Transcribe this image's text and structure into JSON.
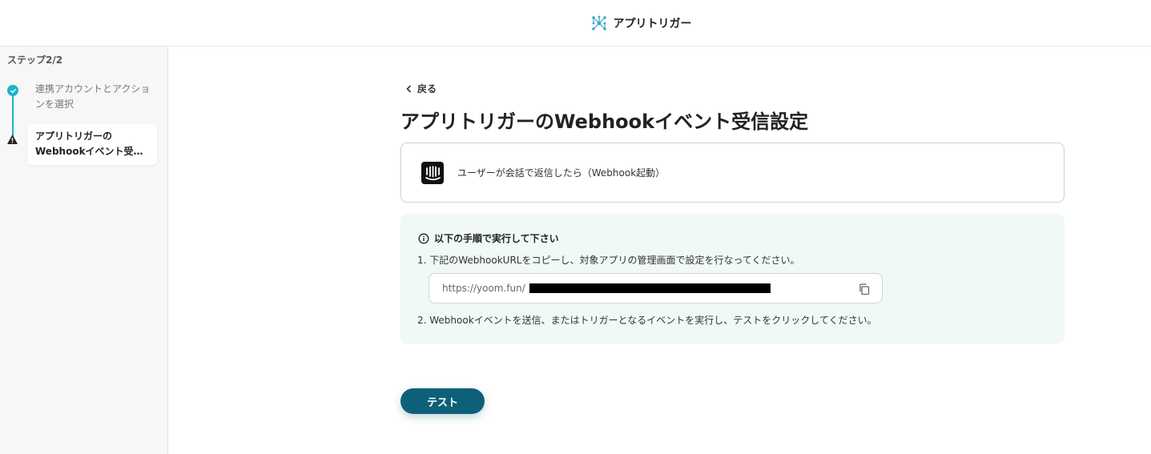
{
  "header": {
    "title": "アプリトリガー",
    "logo_icon": "network-nodes-icon"
  },
  "sidebar": {
    "step_count": "ステップ2/2",
    "steps": [
      {
        "label": "連携アカウントとアクションを選択",
        "status": "complete",
        "icon": "check-circle-icon"
      },
      {
        "label": "アプリトリガーのWebhookイベント受…",
        "status": "warning",
        "icon": "warning-icon"
      }
    ]
  },
  "main": {
    "back_label": "戻る",
    "title": "アプリトリガーのWebhookイベント受信設定",
    "event": {
      "label": "ユーザーが会話で返信したら（Webhook起動）",
      "app_icon": "intercom-icon"
    },
    "instructions": {
      "heading": "以下の手順で実行して下さい",
      "step1": "1. 下記のWebhookURLをコピーし、対象アプリの管理画面で設定を行なってください。",
      "url": "https://yoom.fun/",
      "step2": "2. Webhookイベントを送信、またはトリガーとなるイベントを実行し、テストをクリックしてください。"
    },
    "test_label": "テスト"
  },
  "colors": {
    "accent": "#19b5c9",
    "primary_button": "#0e6079",
    "panel_bg": "#f1f8f8"
  }
}
